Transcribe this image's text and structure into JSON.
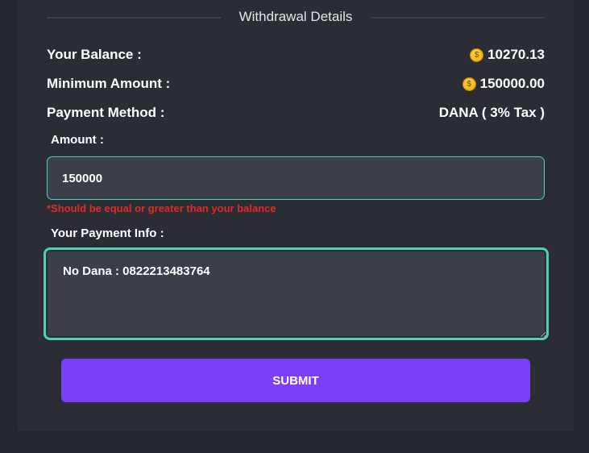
{
  "section": {
    "title": "Withdrawal Details"
  },
  "balance": {
    "label": "Your Balance :",
    "value": "10270.13"
  },
  "minimum": {
    "label": "Minimum Amount :",
    "value": "150000.00"
  },
  "method": {
    "label": "Payment Method :",
    "value": "DANA ( 3% Tax )"
  },
  "amount": {
    "label": "Amount :",
    "value": "150000",
    "error": "*Should be equal or greater than your balance"
  },
  "payment_info": {
    "label": "Your Payment Info :",
    "value": "No Dana : 0822213483764"
  },
  "submit": {
    "label": "SUBMIT"
  },
  "colors": {
    "accent": "#7b3ff7",
    "border": "#4fd1b5",
    "error": "#e02b2b",
    "coin": "#f5b400"
  },
  "icons": {
    "coin": "coin-icon"
  }
}
